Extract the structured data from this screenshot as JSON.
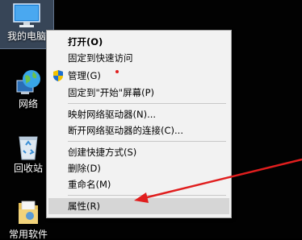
{
  "desktop": {
    "icons": [
      {
        "label": "我的电脑"
      },
      {
        "label": "网络"
      },
      {
        "label": "回收站"
      },
      {
        "label": "常用软件"
      }
    ]
  },
  "context_menu": {
    "items": [
      {
        "label": "打开(O)"
      },
      {
        "label": "固定到快速访问"
      },
      {
        "label": "管理(G)"
      },
      {
        "label": "固定到\"开始\"屏幕(P)"
      },
      {
        "label": "映射网络驱动器(N)..."
      },
      {
        "label": "断开网络驱动器的连接(C)..."
      },
      {
        "label": "创建快捷方式(S)"
      },
      {
        "label": "删除(D)"
      },
      {
        "label": "重命名(M)"
      },
      {
        "label": "属性(R)"
      }
    ]
  },
  "annotation": {
    "arrow_color": "#e01e1e"
  }
}
